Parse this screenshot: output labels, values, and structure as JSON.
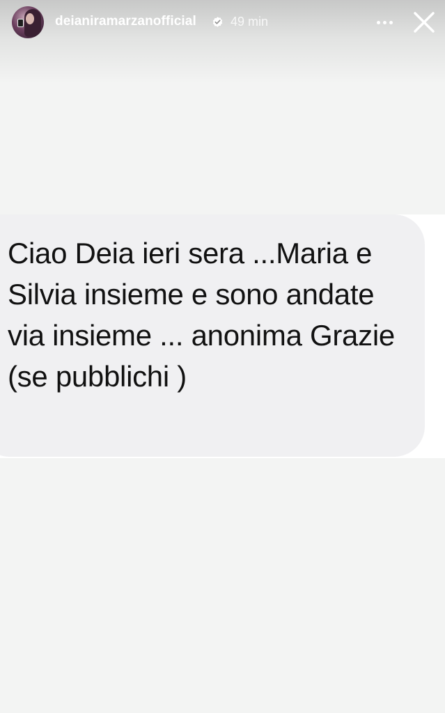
{
  "story": {
    "username": "deianiramarzanofficial",
    "time": "49 min",
    "message": "Ciao Deia ieri sera ...Maria e Silvia insieme e sono andate via insieme ... anonima Grazie (se pubblichi )"
  },
  "icons": {
    "verified": "verified-badge-icon",
    "more": "more-options-icon",
    "close": "close-icon"
  },
  "colors": {
    "background": "#f3f4f3",
    "bubble": "#f0f0f2",
    "text": "#111111",
    "header_text": "#ffffff"
  }
}
